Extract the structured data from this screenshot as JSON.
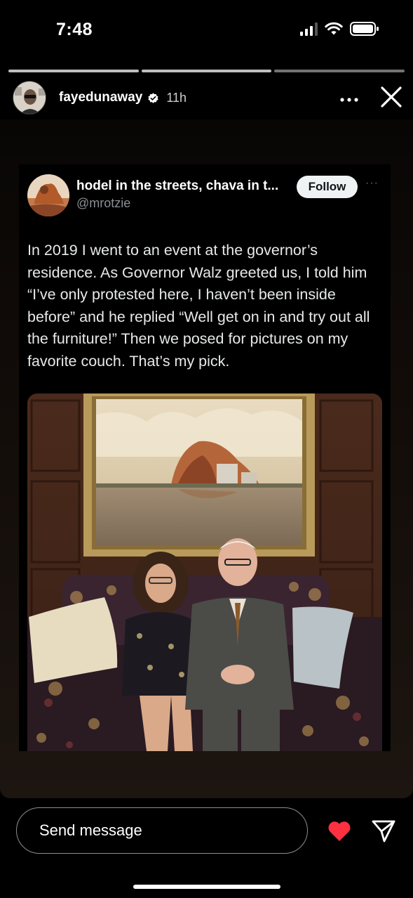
{
  "status_bar": {
    "time": "7:48"
  },
  "story": {
    "username": "fayedunaway",
    "time_ago": "11h",
    "segments": 3,
    "current_segment": 2
  },
  "tweet": {
    "display_name": "hodel in the streets, chava in t...",
    "handle": "@mrotzie",
    "follow_label": "Follow",
    "more_label": "···",
    "text": "In 2019 I went to an event at the governor’s residence. As Governor Walz greeted us, I told him “I’ve only protested here, I haven’t been inside before” and he replied “Well get on in and try out all the furniture!” Then we posed for pictures on my favorite couch. That’s my pick."
  },
  "reply": {
    "placeholder": "Send message"
  },
  "colors": {
    "like": "#ff3040",
    "follow_bg": "#eff3f4",
    "handle": "#8b8f94"
  },
  "icons": [
    "wifi-icon",
    "battery-icon",
    "verified-badge-icon",
    "more-icon",
    "close-icon",
    "heart-icon",
    "send-icon"
  ]
}
